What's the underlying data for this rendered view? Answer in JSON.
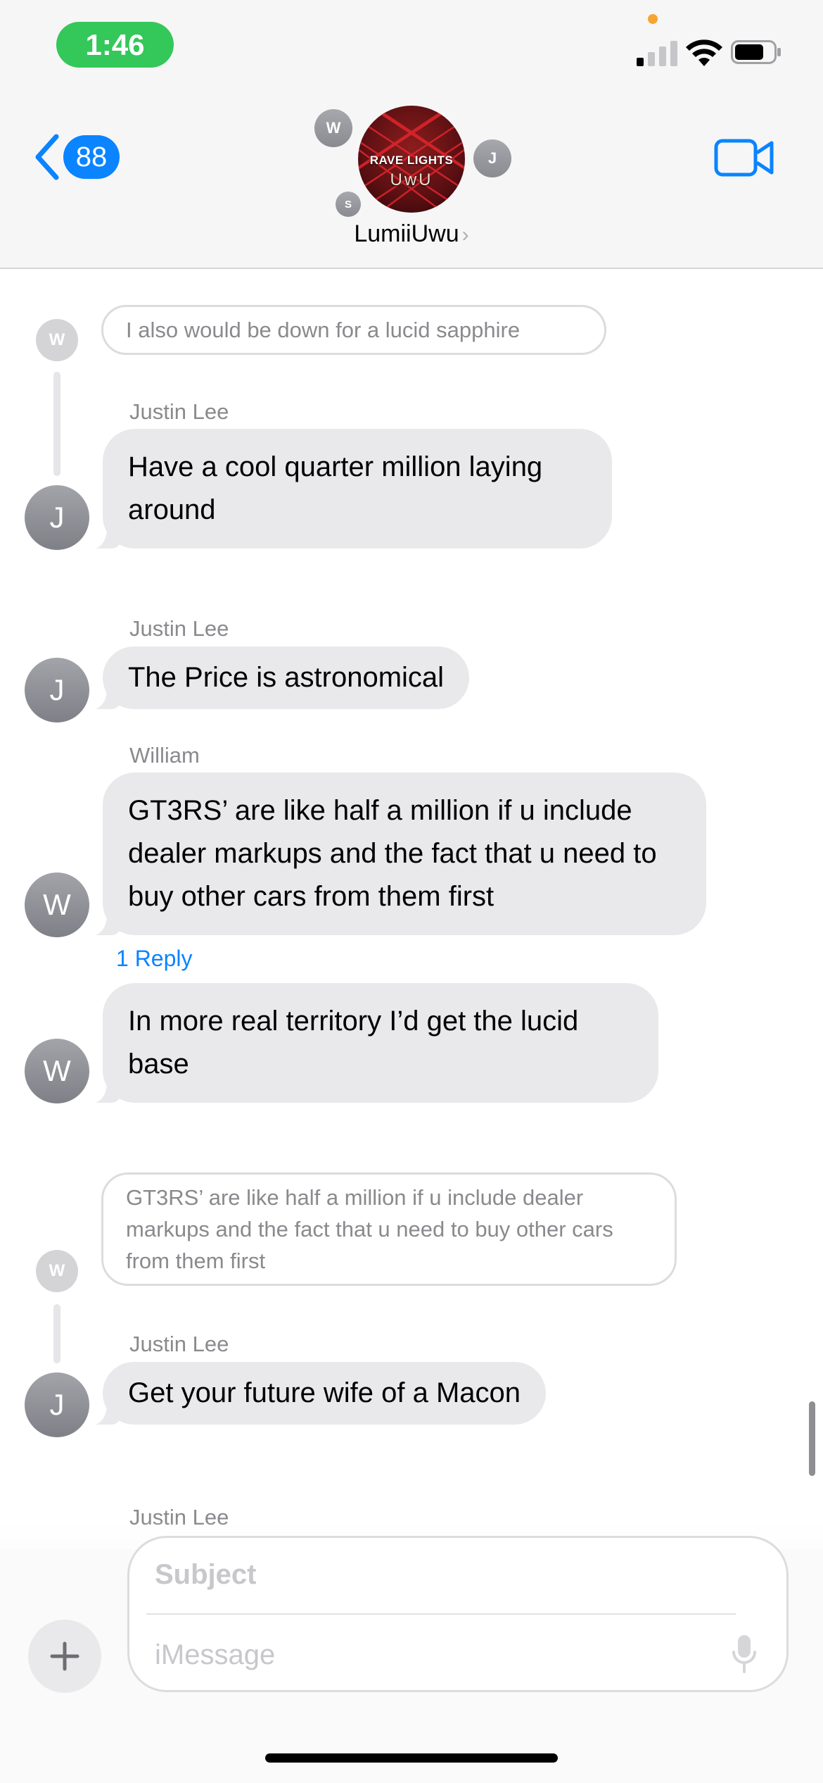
{
  "status_bar": {
    "time": "1:46",
    "signal_bars_active": 1,
    "signal_bars_total": 4
  },
  "nav": {
    "back_count": "88",
    "group_name": "LumiiUwu",
    "group_avatar_text_1": "RAVE LIGHTS",
    "group_avatar_text_2": "UwU",
    "participants": [
      "W",
      "J",
      "S"
    ]
  },
  "messages": [
    {
      "type": "quote",
      "avatar": "W",
      "text": "I also would be down for a lucid sapphire"
    },
    {
      "type": "message",
      "sender": "Justin Lee",
      "avatar": "J",
      "text": "Have a cool quarter million laying around"
    },
    {
      "type": "message",
      "sender": "Justin Lee",
      "avatar": "J",
      "text": "The Price is astronomical"
    },
    {
      "type": "message",
      "sender": "William",
      "avatar": "W",
      "text": "GT3RS’ are like half a million if u include dealer markups and the fact that u need to buy other cars from them first",
      "reply_link": "1 Reply"
    },
    {
      "type": "message",
      "avatar": "W",
      "text": "In more real territory I’d get the lucid base"
    },
    {
      "type": "quote",
      "avatar": "W",
      "text": "GT3RS’ are like half a million if u include dealer markups and the fact that u need to buy other cars from them first"
    },
    {
      "type": "message",
      "sender": "Justin Lee",
      "avatar": "J",
      "text": "Get your future wife of a Macon"
    },
    {
      "type": "sender_only",
      "sender": "Justin Lee"
    }
  ],
  "composer": {
    "subject_placeholder": "Subject",
    "message_placeholder": "iMessage"
  },
  "colors": {
    "accent": "#0a84ff",
    "time_pill": "#34c759",
    "bubble": "#e9e9eb"
  },
  "icons": [
    "signal-icon",
    "wifi-icon",
    "battery-icon",
    "back-chevron-icon",
    "video-camera-icon",
    "plus-icon",
    "microphone-icon"
  ]
}
